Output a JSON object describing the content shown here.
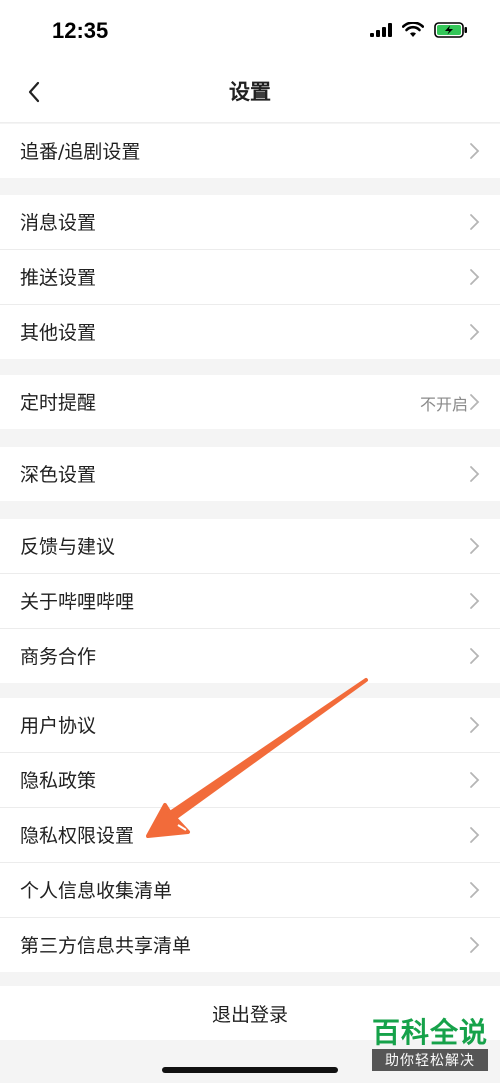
{
  "status_bar": {
    "time": "12:35"
  },
  "nav": {
    "title": "设置"
  },
  "groups": [
    {
      "items": [
        {
          "label": "追番/追剧设置"
        }
      ]
    },
    {
      "items": [
        {
          "label": "消息设置"
        },
        {
          "label": "推送设置"
        },
        {
          "label": "其他设置"
        }
      ]
    },
    {
      "items": [
        {
          "label": "定时提醒",
          "value": "不开启"
        }
      ]
    },
    {
      "items": [
        {
          "label": "深色设置"
        }
      ]
    },
    {
      "items": [
        {
          "label": "反馈与建议"
        },
        {
          "label": "关于哔哩哔哩"
        },
        {
          "label": "商务合作"
        }
      ]
    },
    {
      "items": [
        {
          "label": "用户协议"
        },
        {
          "label": "隐私政策"
        },
        {
          "label": "隐私权限设置"
        },
        {
          "label": "个人信息收集清单"
        },
        {
          "label": "第三方信息共享清单"
        }
      ]
    }
  ],
  "logout": {
    "label": "退出登录"
  },
  "watermark": {
    "title": "百科全说",
    "subtitle": "助你轻松解决"
  },
  "colors": {
    "annotation_arrow": "#f26b3a",
    "watermark_green": "#16a24a"
  }
}
